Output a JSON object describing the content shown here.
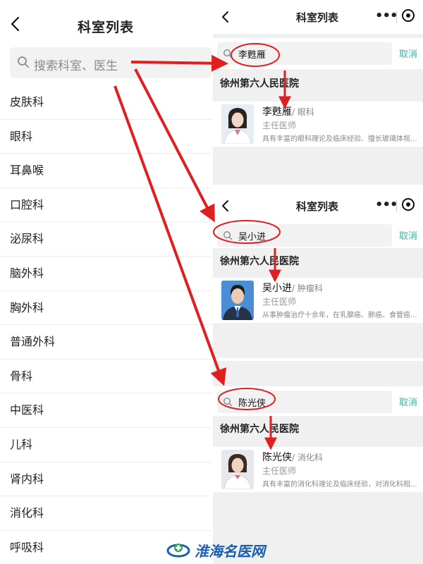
{
  "left": {
    "title": "科室列表",
    "search_placeholder": "搜索科室、医生",
    "departments": [
      "皮肤科",
      "眼科",
      "耳鼻喉",
      "口腔科",
      "泌尿科",
      "脑外科",
      "胸外科",
      "普通外科",
      "骨科",
      "中医科",
      "儿科",
      "肾内科",
      "消化科",
      "呼吸科"
    ]
  },
  "panels": [
    {
      "title": "科室列表",
      "query": "李甦雁",
      "cancel": "取消",
      "hospital": "徐州第六人民医院",
      "doctor": {
        "name": "李甦雁",
        "dept": "/ 眼科",
        "role": "主任医师",
        "desc": "具有丰富的眼科理论及临床经验、擅长玻璃体视..."
      }
    },
    {
      "title": "科室列表",
      "query": "吴小进",
      "cancel": "取消",
      "hospital": "徐州第六人民医院",
      "doctor": {
        "name": "吴小进",
        "dept": "/ 肿瘤科",
        "role": "主任医师",
        "desc": "从事肿瘤治疗十余年，在乳腺癌、肺癌、食管癌..."
      }
    },
    {
      "query": "陈光侠",
      "cancel": "取消",
      "hospital": "徐州第六人民医院",
      "doctor": {
        "name": "陈光侠",
        "dept": "/ 消化科",
        "role": "主任医师",
        "desc": "具有丰富的消化科理论及临床经验，对消化科相..."
      }
    }
  ],
  "watermark": "淮海名医网",
  "colors": {
    "arrow": "#e02020",
    "accent": "#3bb3a4",
    "watermark": "#1a5fb4"
  }
}
